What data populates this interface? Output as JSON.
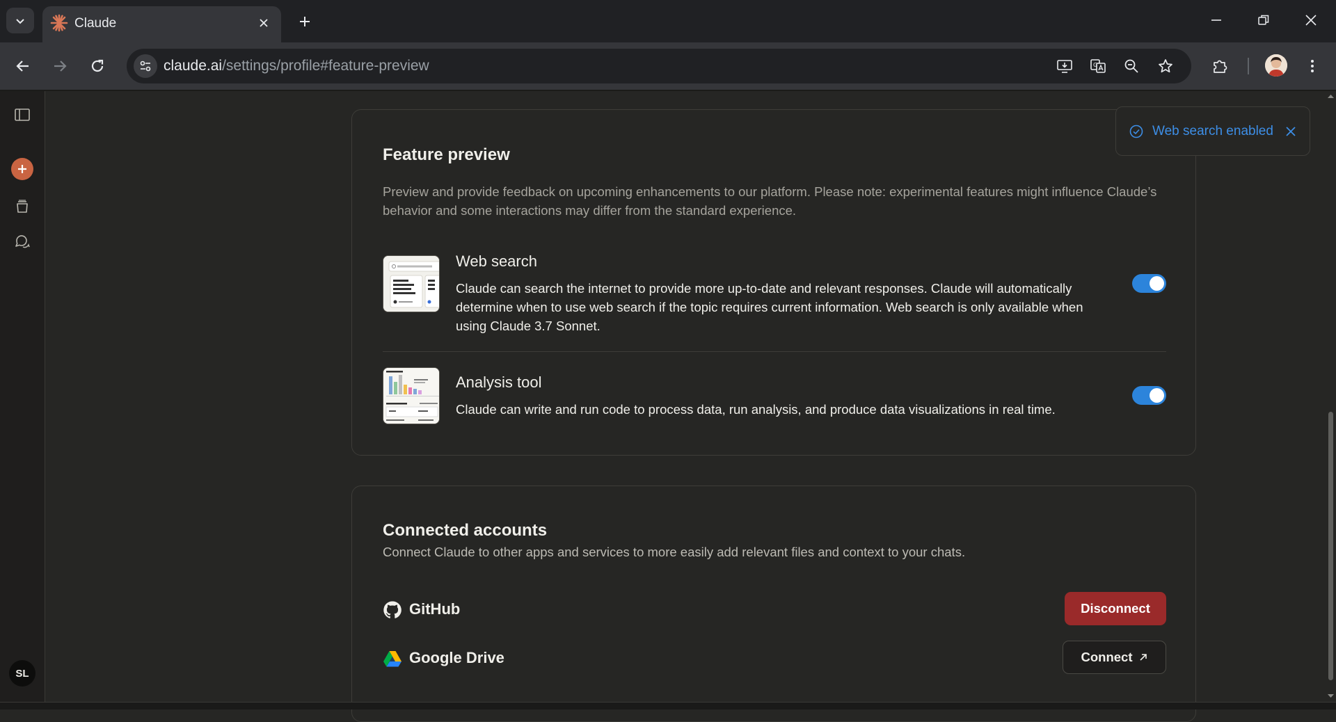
{
  "browser": {
    "tab_title": "Claude",
    "url_host": "claude.ai",
    "url_path": "/settings/profile#feature-preview"
  },
  "sidebar": {
    "user_initials": "SL"
  },
  "feature_preview": {
    "title": "Feature preview",
    "description": "Preview and provide feedback on upcoming enhancements to our platform. Please note: experimental features might influence Claude’s behavior and some interactions may differ from the standard experience.",
    "features": [
      {
        "title": "Web search",
        "description": "Claude can search the internet to provide more up-to-date and relevant responses. Claude will automatically determine when to use web search if the topic requires current information. Web search is only available when using Claude 3.7 Sonnet.",
        "enabled": true
      },
      {
        "title": "Analysis tool",
        "description": "Claude can write and run code to process data, run analysis, and produce data visualizations in real time.",
        "enabled": true
      }
    ]
  },
  "connected_accounts": {
    "title": "Connected accounts",
    "description": "Connect Claude to other apps and services to more easily add relevant files and context to your chats.",
    "accounts": [
      {
        "name": "GitHub",
        "action_label": "Disconnect"
      },
      {
        "name": "Google Drive",
        "action_label": "Connect"
      }
    ]
  },
  "toast": {
    "message": "Web search enabled"
  },
  "colors": {
    "accent_blue": "#2c84db",
    "brand_orange": "#c96442",
    "danger": "#9a2a2a"
  }
}
